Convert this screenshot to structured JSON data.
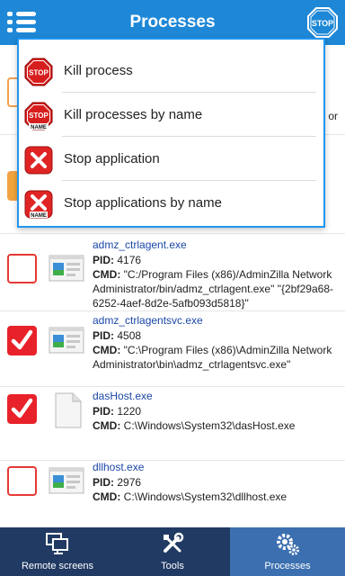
{
  "header": {
    "title": "Processes"
  },
  "menu": {
    "items": [
      {
        "label": "Kill process",
        "icon": "stop-sign-icon"
      },
      {
        "label": "Kill processes by name",
        "icon": "stop-name-icon"
      },
      {
        "label": "Stop application",
        "icon": "red-x-icon"
      },
      {
        "label": "Stop applications by name",
        "icon": "red-x-name-icon"
      }
    ]
  },
  "ghost": {
    "cmd_tail": "or"
  },
  "processes": [
    {
      "name": "admz_ctrlagent.exe",
      "pid_label": "PID:",
      "pid": "4176",
      "cmd_label": "CMD:",
      "cmd": "\"C:/Program Files (x86)/AdminZilla Network Administrator/bin/admz_ctrlagent.exe\" \"{2bf29a68-6252-4aef-8d2e-5afb093d5818}\"",
      "checked": false
    },
    {
      "name": "admz_ctrlagentsvc.exe",
      "pid_label": "PID:",
      "pid": "4508",
      "cmd_label": "CMD:",
      "cmd": "\"C:\\Program Files (x86)\\AdminZilla Network Administrator\\bin\\admz_ctrlagentsvc.exe\"",
      "checked": true
    },
    {
      "name": "dasHost.exe",
      "pid_label": "PID:",
      "pid": "1220",
      "cmd_label": "CMD:",
      "cmd": "C:\\Windows\\System32\\dasHost.exe",
      "checked": true
    },
    {
      "name": "dllhost.exe",
      "pid_label": "PID:",
      "pid": "2976",
      "cmd_label": "CMD:",
      "cmd": "C:\\Windows\\System32\\dllhost.exe",
      "checked": false
    }
  ],
  "nav": {
    "items": [
      {
        "label": "Remote screens",
        "icon": "monitors-icon",
        "active": false
      },
      {
        "label": "Tools",
        "icon": "tools-icon",
        "active": false
      },
      {
        "label": "Processes",
        "icon": "gears-icon",
        "active": true
      }
    ]
  },
  "colors": {
    "header": "#1e88d6",
    "accent": "#2196f3",
    "checkbox": "#e8222a",
    "nav_bg": "#203a63",
    "nav_active": "#3b6fb0",
    "link": "#1a47a6"
  }
}
